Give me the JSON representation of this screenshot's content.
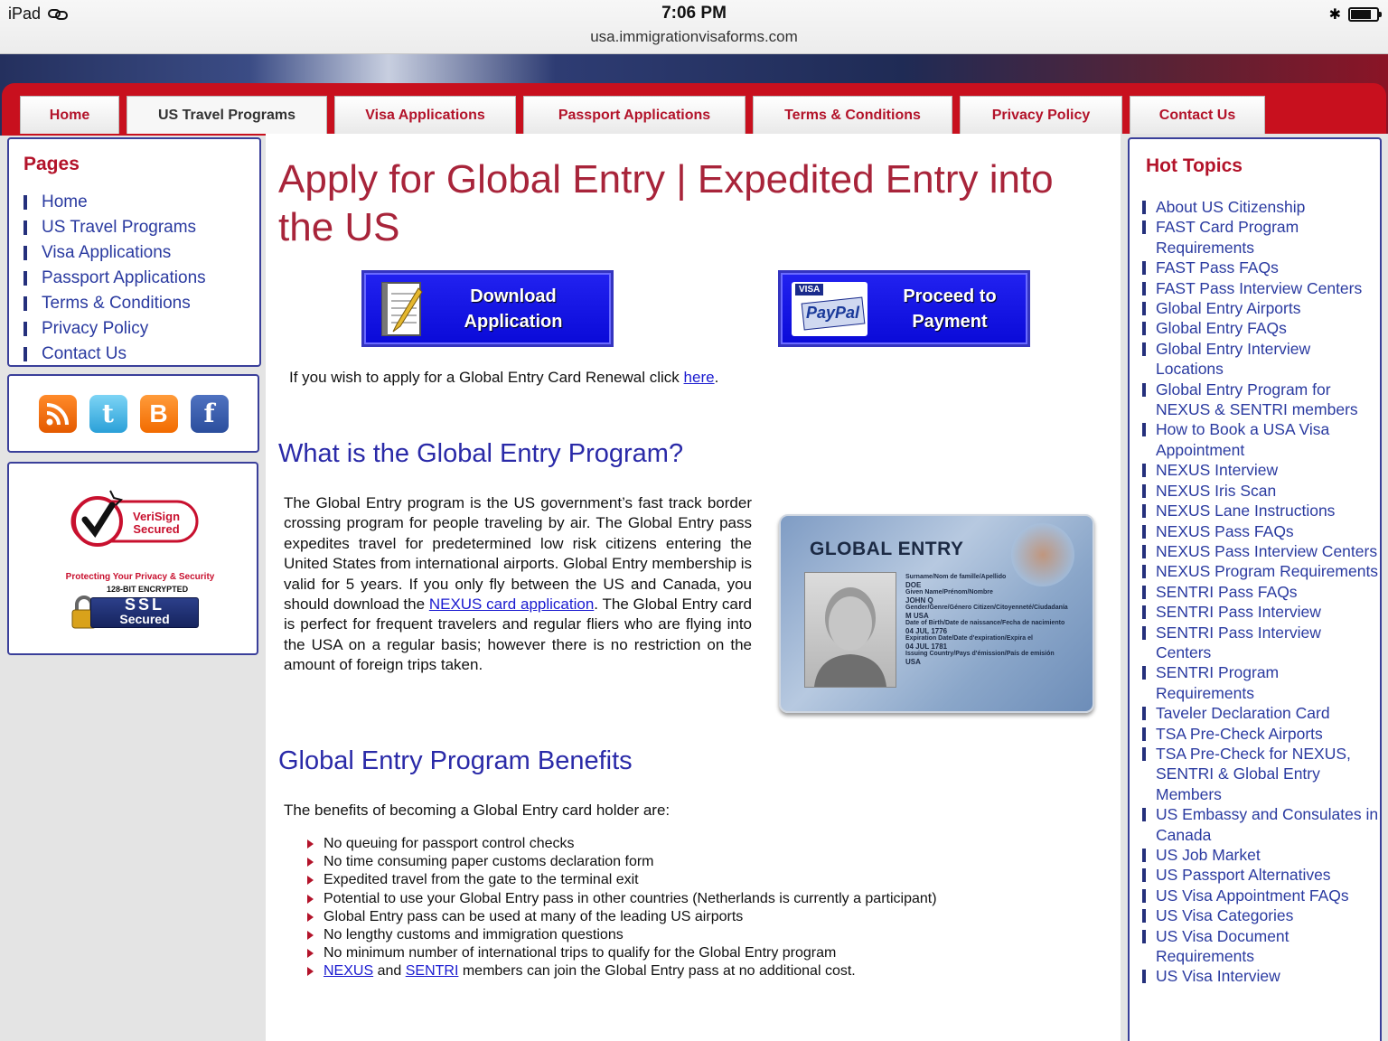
{
  "status": {
    "device": "iPad",
    "time": "7:06 PM",
    "url": "usa.immigrationvisaforms.com",
    "battery": 0.8
  },
  "nav": [
    {
      "label": "Home",
      "width": 110
    },
    {
      "label": "US Travel Programs",
      "width": 222
    },
    {
      "label": "Visa Applications",
      "width": 201
    },
    {
      "label": "Passport Applications",
      "width": 246
    },
    {
      "label": "Terms & Conditions",
      "width": 221
    },
    {
      "label": "Privacy Policy",
      "width": 180
    },
    {
      "label": "Contact Us",
      "width": 150
    }
  ],
  "pages": {
    "title": "Pages",
    "items": [
      "Home",
      "US Travel Programs",
      "Visa Applications",
      "Passport Applications",
      "Terms & Conditions",
      "Privacy Policy",
      "Contact Us"
    ]
  },
  "social": [
    "rss-icon",
    "twitter-icon",
    "blogger-icon",
    "facebook-icon"
  ],
  "badges": {
    "verisign": "VeriSign Secured",
    "protect": "Protecting Your Privacy & Security",
    "encrypted": "128-BIT ENCRYPTED",
    "ssl": "SSL",
    "secured": "Secured"
  },
  "main": {
    "title": "Apply for Global Entry | Expedited Entry into the US",
    "download_btn": "Download Application",
    "payment_btn": "Proceed to Payment",
    "paypal_visa": "VISA",
    "paypal": "PayPal",
    "renew_text": "If you wish to apply for a Global Entry Card Renewal click ",
    "renew_link": "here",
    "renew_end": ".",
    "what_heading": "What is the Global Entry Program?",
    "what_p1": "The Global Entry program is the US government’s fast track border crossing program for people traveling by air. The Global Entry pass expedites travel for predetermined low risk citizens entering the United States from international airports. Global Entry membership is valid for 5 years. If you only fly between the US and Canada, you should download the ",
    "what_link": "NEXUS card application",
    "what_p2": ". The Global Entry card is perfect for frequent travelers and regular fliers who are  flying into the USA on a regular basis; however there is no restriction on the amount of foreign trips taken.",
    "card_title": "GLOBAL ENTRY",
    "card_lines": [
      "Surname/Nom de famille/Apellido",
      "DOE",
      "Given Name/Prénom/Nombre",
      "JOHN Q",
      "Gender/Genre/Género   Citizen/Citoyenneté/Ciudadanía",
      "M                     USA",
      "Date of Birth/Date de naissance/Fecha de nacimiento",
      "04 JUL 1776",
      "Expiration Date/Date d'expiration/Expira el",
      "04 JUL 1781",
      "Issuing Country/Pays d'émission/País de emisión",
      "USA"
    ],
    "benefits_heading": "Global Entry Program Benefits",
    "benefits_intro": "The benefits of becoming a Global Entry card holder are:",
    "benefits": [
      "No queuing for passport control checks",
      "No time consuming paper customs declaration form",
      "Expedited travel from the gate to the terminal exit",
      "Potential to use your Global Entry pass in other countries (Netherlands is currently a participant)",
      "Global Entry pass can be used at many of the leading US airports",
      "No lengthy customs and immigration questions",
      "No minimum number of international trips to qualify for the Global Entry program"
    ],
    "last_benefit": {
      "link1": "NEXUS",
      "and": " and ",
      "link2": "SENTRI",
      "rest": " members can join the Global Entry pass at no additional cost."
    }
  },
  "hot": {
    "title": "Hot Topics",
    "items": [
      "About US Citizenship",
      "FAST Card Program Requirements",
      "FAST Pass FAQs",
      "FAST Pass Interview Centers",
      "Global Entry Airports",
      "Global Entry FAQs",
      "Global Entry Interview Locations",
      "Global Entry Program for NEXUS & SENTRI members",
      "How to Book a USA Visa Appointment",
      "NEXUS Interview",
      "NEXUS Iris Scan",
      "NEXUS Lane Instructions",
      "NEXUS Pass FAQs",
      "NEXUS Pass Interview Centers",
      "NEXUS Program Requirements",
      "SENTRI Pass FAQs",
      "SENTRI Pass Interview",
      "SENTRI Pass Interview Centers",
      "SENTRI Program Requirements",
      "Taveler Declaration Card",
      "TSA Pre-Check Airports",
      "TSA Pre-Check for NEXUS, SENTRI & Global Entry Members",
      "US Embassy and Consulates in Canada",
      "US Job Market",
      "US Passport Alternatives",
      "US Visa Appointment FAQs",
      "US Visa Categories",
      "US Visa Document Requirements",
      "US Visa Interview"
    ]
  }
}
